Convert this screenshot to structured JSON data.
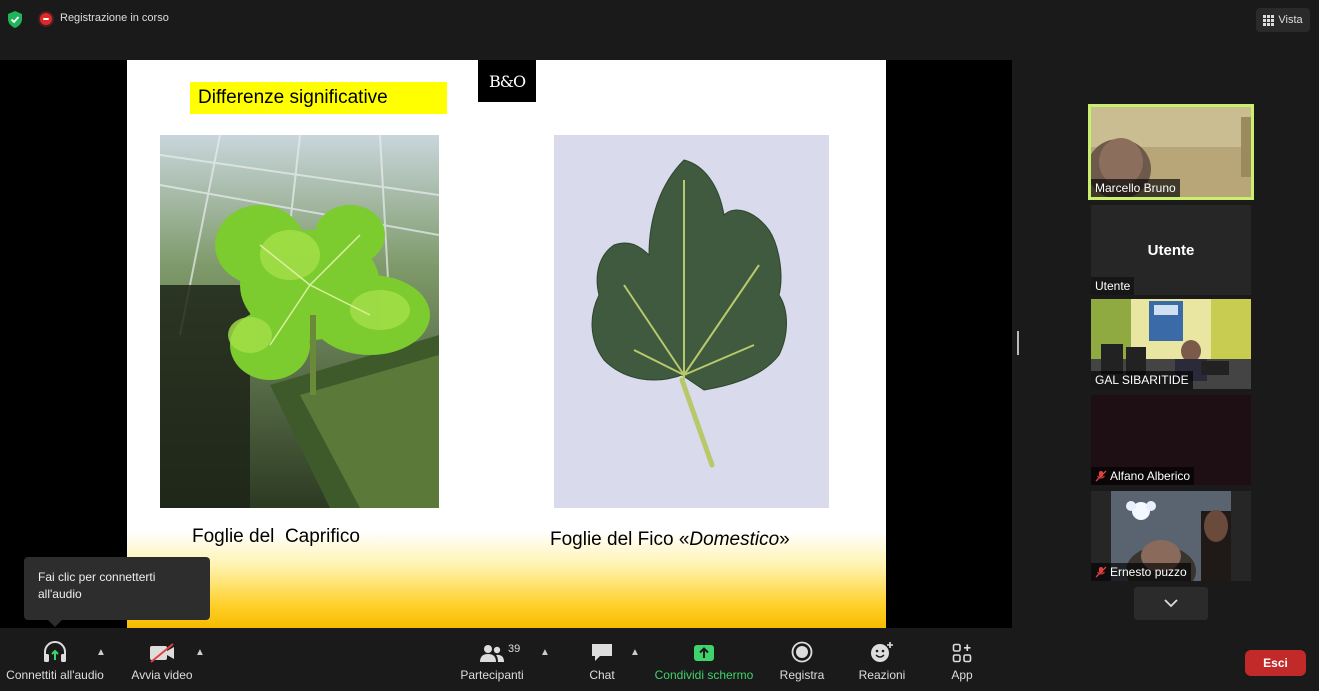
{
  "topbar": {
    "recording_label": "Registrazione in corso",
    "view_label": "Vista"
  },
  "slide": {
    "logo_text": "B&O",
    "title": "Differenze significative",
    "caption_left": "Foglie del  Caprifico",
    "caption_right_prefix": "Foglie del Fico «",
    "caption_right_italic": "Domestico",
    "caption_right_suffix": "»"
  },
  "participants": [
    {
      "name": "Marcello Bruno",
      "active": true
    },
    {
      "name": "Utente",
      "center_label": "Utente"
    },
    {
      "name": "GAL SIBARITIDE"
    },
    {
      "name": "Alfano Alberico",
      "muted": true
    },
    {
      "name": "Ernesto puzzo",
      "muted": true
    }
  ],
  "tooltip": {
    "text": "Fai clic per connetterti all'audio"
  },
  "toolbar": {
    "audio_label": "Connettiti all'audio",
    "video_label": "Avvia video",
    "participants_label": "Partecipanti",
    "participants_count": "39",
    "chat_label": "Chat",
    "share_label": "Condividi schermo",
    "record_label": "Registra",
    "reactions_label": "Reazioni",
    "apps_label": "App",
    "leave_label": "Esci"
  },
  "colors": {
    "active_speaker_border": "#c8f06e",
    "share_green": "#3fd36b",
    "leave_red": "#c22a2a",
    "title_highlight": "#ffff00"
  }
}
